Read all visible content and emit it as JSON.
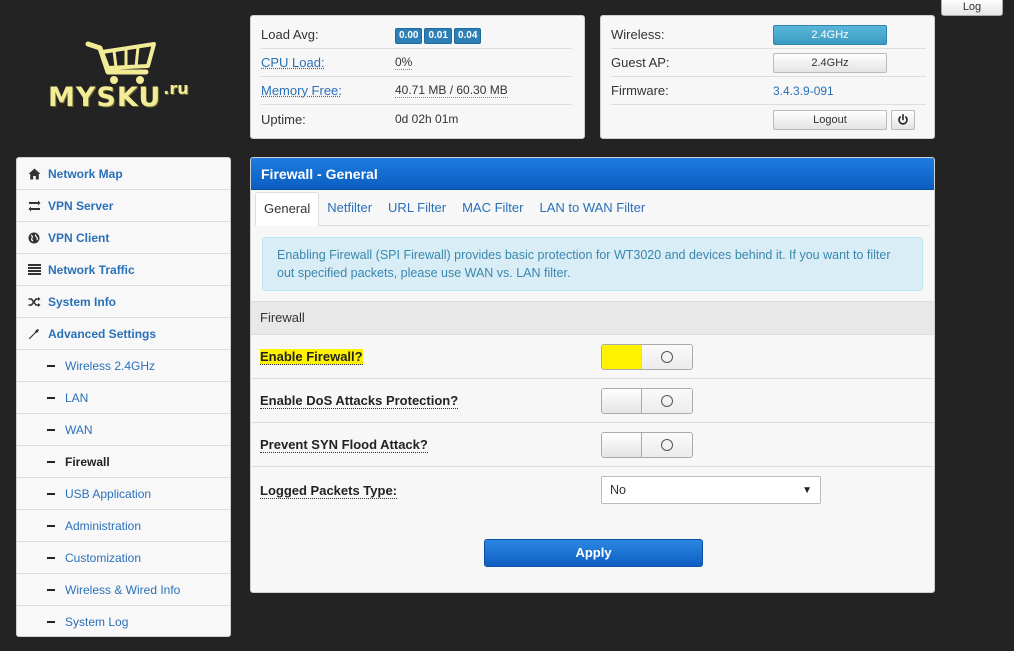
{
  "logo": {
    "brand": "MYSKU",
    "suffix": ".ru"
  },
  "top_right": {
    "log_label": "Log"
  },
  "status": {
    "rows": [
      {
        "label": "Load Avg:",
        "badges": [
          "0.00",
          "0.01",
          "0.04"
        ]
      },
      {
        "label": "CPU Load:",
        "value": "0%"
      },
      {
        "label": "Memory Free:",
        "value": "40.71 MB / 60.30 MB"
      },
      {
        "label": "Uptime:",
        "value": "0d 02h 01m"
      }
    ]
  },
  "system": {
    "wireless_label": "Wireless:",
    "wireless_button": "2.4GHz",
    "guest_label": "Guest AP:",
    "guest_button": "2.4GHz",
    "firmware_label": "Firmware:",
    "firmware_value": "3.4.3.9-091",
    "logout_label": "Logout"
  },
  "sidebar": {
    "items": [
      {
        "label": "Network Map",
        "icon": "home-icon"
      },
      {
        "label": "VPN Server",
        "icon": "swap-icon"
      },
      {
        "label": "VPN Client",
        "icon": "globe-icon"
      },
      {
        "label": "Network Traffic",
        "icon": "list-icon"
      },
      {
        "label": "System Info",
        "icon": "shuffle-icon"
      },
      {
        "label": "Advanced Settings",
        "icon": "wrench-icon"
      }
    ],
    "subitems": [
      {
        "label": "Wireless 2.4GHz",
        "active": false
      },
      {
        "label": "LAN",
        "active": false
      },
      {
        "label": "WAN",
        "active": false
      },
      {
        "label": "Firewall",
        "active": true
      },
      {
        "label": "USB Application",
        "active": false
      },
      {
        "label": "Administration",
        "active": false
      },
      {
        "label": "Customization",
        "active": false
      },
      {
        "label": "Wireless & Wired Info",
        "active": false
      },
      {
        "label": "System Log",
        "active": false
      }
    ]
  },
  "main": {
    "title": "Firewall - General",
    "tabs": [
      "General",
      "Netfilter",
      "URL Filter",
      "MAC Filter",
      "LAN to WAN Filter"
    ],
    "info": "Enabling Firewall (SPI Firewall) provides basic protection for WT3020 and devices behind it. If you want to filter out specified packets, please use WAN vs. LAN filter.",
    "section": "Firewall",
    "fields": {
      "enable_firewall": "Enable Firewall?",
      "dos": "Enable DoS Attacks Protection?",
      "syn": "Prevent SYN Flood Attack?",
      "logged": "Logged Packets Type:",
      "logged_value": "No"
    },
    "apply_label": "Apply"
  },
  "colors": {
    "accent": "#0b5dc0",
    "link": "#2a70b8",
    "highlight": "#fff200",
    "background": "#232323"
  }
}
